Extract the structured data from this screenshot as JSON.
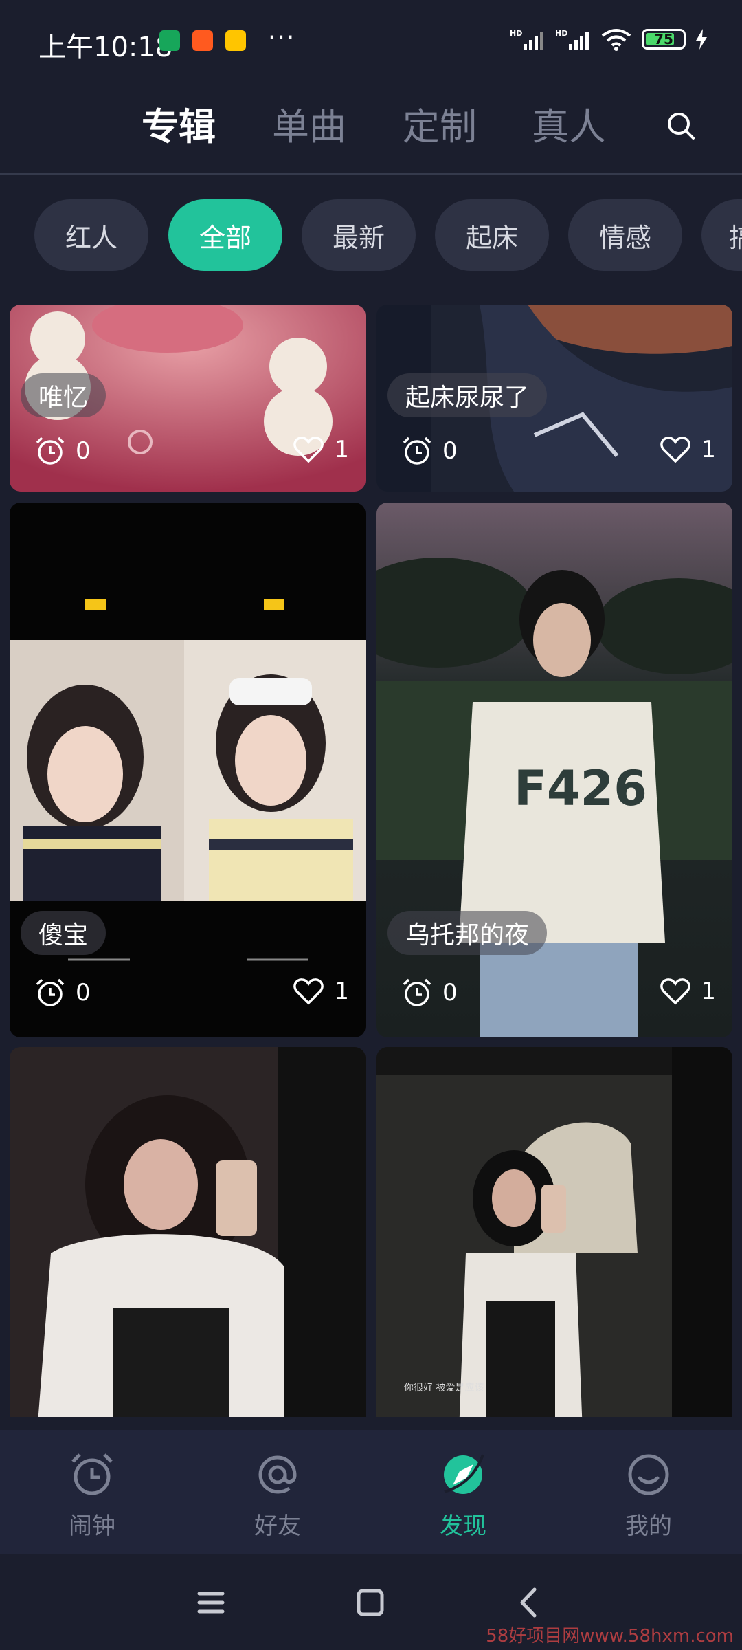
{
  "status_bar": {
    "time": "上午10:18",
    "battery_level": "75",
    "more": "···"
  },
  "top_tabs": [
    {
      "label": "专辑",
      "active": true
    },
    {
      "label": "单曲",
      "active": false
    },
    {
      "label": "定制",
      "active": false
    },
    {
      "label": "真人",
      "active": false
    }
  ],
  "chips": [
    {
      "label": "红人",
      "active": false
    },
    {
      "label": "全部",
      "active": true
    },
    {
      "label": "最新",
      "active": false
    },
    {
      "label": "起床",
      "active": false
    },
    {
      "label": "情感",
      "active": false
    },
    {
      "label": "搞",
      "active": false
    }
  ],
  "cards": [
    {
      "title": "唯忆",
      "alarm_count": "0",
      "like_count": "1"
    },
    {
      "title": "起床尿尿了",
      "alarm_count": "0",
      "like_count": "1"
    },
    {
      "title": "傻宝",
      "alarm_count": "0",
      "like_count": "1"
    },
    {
      "title": "乌托邦的夜",
      "alarm_count": "0",
      "like_count": "1"
    },
    {
      "title": "",
      "alarm_count": "",
      "like_count": ""
    },
    {
      "title": "",
      "alarm_count": "",
      "like_count": ""
    }
  ],
  "bottom_nav": [
    {
      "label": "闹钟",
      "icon": "alarm-clock-icon",
      "active": false
    },
    {
      "label": "好友",
      "icon": "at-sign-icon",
      "active": false
    },
    {
      "label": "发现",
      "icon": "discover-compass-icon",
      "active": true
    },
    {
      "label": "我的",
      "icon": "smiley-face-icon",
      "active": false
    }
  ],
  "watermark": "58好项目网www.58hxm.com",
  "colors": {
    "background": "#1b1e2d",
    "accent": "#22c39b",
    "chip_bg": "#2e3244",
    "inactive_text": "#7c8194"
  }
}
